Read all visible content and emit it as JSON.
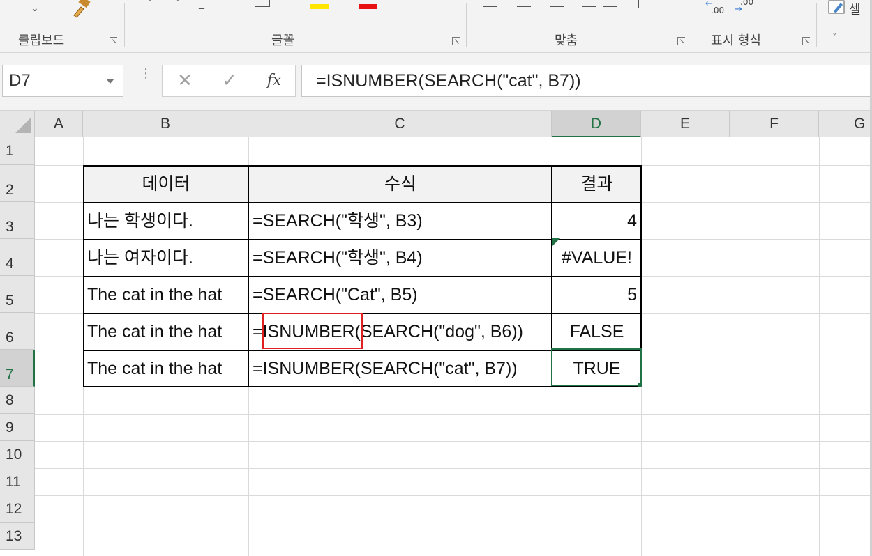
{
  "ribbon": {
    "groups": [
      {
        "label": "클립보드"
      },
      {
        "label": "글꼴"
      },
      {
        "label": "맞춤"
      },
      {
        "label": "표시 형식"
      }
    ],
    "number_format_labels": {
      "increase": ".00",
      "decrease": ".00"
    },
    "cell_style_label": "셀",
    "colors": {
      "highlight": "#ffe600",
      "font_color": "#e81010",
      "accent": "#217346"
    }
  },
  "formula_bar": {
    "name_box": "D7",
    "cancel_glyph": "✕",
    "enter_glyph": "✓",
    "fx_label": "fx",
    "formula": "=ISNUMBER(SEARCH(\"cat\", B7))"
  },
  "grid": {
    "columns": [
      "A",
      "B",
      "C",
      "D",
      "E",
      "F",
      "G"
    ],
    "rows": [
      "1",
      "2",
      "3",
      "4",
      "5",
      "6",
      "7",
      "8",
      "9",
      "10",
      "11",
      "12",
      "13"
    ],
    "active_cell": "D7"
  },
  "table": {
    "headers": [
      "데이터",
      "수식",
      "결과"
    ],
    "rows": [
      {
        "data": "나는 학생이다.",
        "formula": "=SEARCH(\"학생\", B3)",
        "result": "4"
      },
      {
        "data": "나는 여자이다.",
        "formula": "=SEARCH(\"학생\", B4)",
        "result": "#VALUE!"
      },
      {
        "data": "The cat in the hat",
        "formula": "=SEARCH(\"Cat\", B5)",
        "result": "5"
      },
      {
        "data": "The cat in the hat",
        "formula": "=ISNUMBER(SEARCH(\"dog\", B6))",
        "result": "FALSE"
      },
      {
        "data": "The cat in the hat",
        "formula": "=ISNUMBER(SEARCH(\"cat\", B7))",
        "result": "TRUE"
      }
    ]
  }
}
